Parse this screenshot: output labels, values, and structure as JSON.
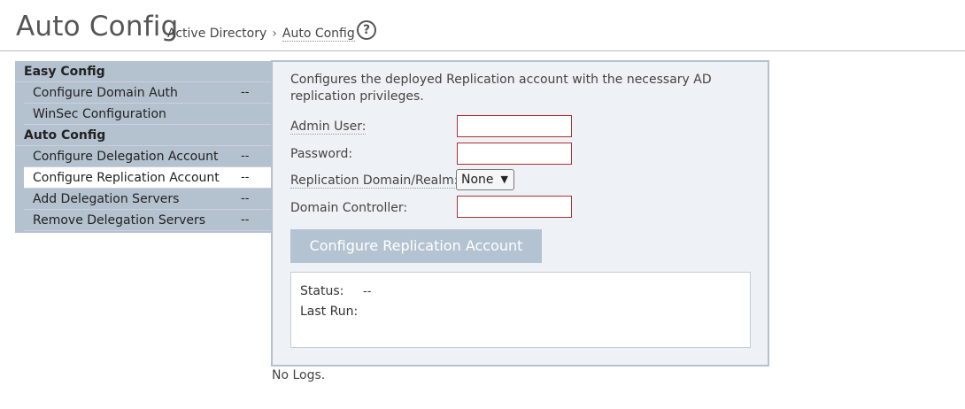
{
  "header": {
    "title": "Auto Config",
    "breadcrumb": [
      "Active Directory",
      "Auto Config"
    ],
    "separator": "›",
    "help_glyph": "?",
    "help_icon": "question-circle-icon"
  },
  "sidebar": {
    "groups": [
      {
        "label": "Easy Config",
        "items": [
          {
            "label": "Configure Domain Auth",
            "status": "--"
          },
          {
            "label": "WinSec Configuration",
            "status": ""
          }
        ]
      },
      {
        "label": "Auto Config",
        "items": [
          {
            "label": "Configure Delegation Account",
            "status": "--"
          },
          {
            "label": "Configure Replication Account",
            "status": "--",
            "active": true
          },
          {
            "label": "Add Delegation Servers",
            "status": "--"
          },
          {
            "label": "Remove Delegation Servers",
            "status": "--"
          }
        ]
      }
    ],
    "bg_color": "#b4c1cf"
  },
  "form": {
    "description": "Configures the deployed Replication account with the necessary AD replication privileges.",
    "admin_user_label": "Admin User:",
    "admin_user_value": "",
    "password_label": "Password:",
    "password_value": "",
    "realm_label": "Replication Domain/Realm:",
    "realm_selected": "None",
    "controller_label": "Domain Controller:",
    "controller_value": "",
    "submit_label": "Configure Replication Account"
  },
  "status": {
    "status_label": "Status:",
    "status_value": "--",
    "last_run_label": "Last Run:",
    "last_run_value": ""
  },
  "logs": "No Logs."
}
